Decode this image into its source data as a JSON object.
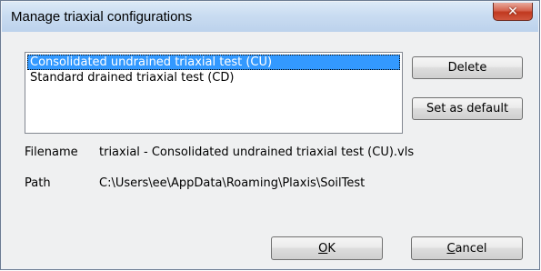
{
  "window": {
    "title": "Manage triaxial configurations",
    "close_glyph": "✕"
  },
  "configurations": {
    "items": [
      {
        "label": "Consolidated undrained triaxial test (CU)",
        "selected": true
      },
      {
        "label": "Standard drained triaxial test (CD)",
        "selected": false
      }
    ]
  },
  "buttons": {
    "delete": "Delete",
    "set_default": "Set as default",
    "ok_mnemonic": "O",
    "ok_rest": "K",
    "cancel_mnemonic": "C",
    "cancel_rest": "ancel"
  },
  "details": {
    "filename_label": "Filename",
    "filename_value": "triaxial - Consolidated undrained triaxial test (CU).vls",
    "path_label": "Path",
    "path_value": "C:\\Users\\ee\\AppData\\Roaming\\Plaxis\\SoilTest"
  },
  "colors": {
    "selection": "#3399ff",
    "close_button": "#c7432a"
  }
}
